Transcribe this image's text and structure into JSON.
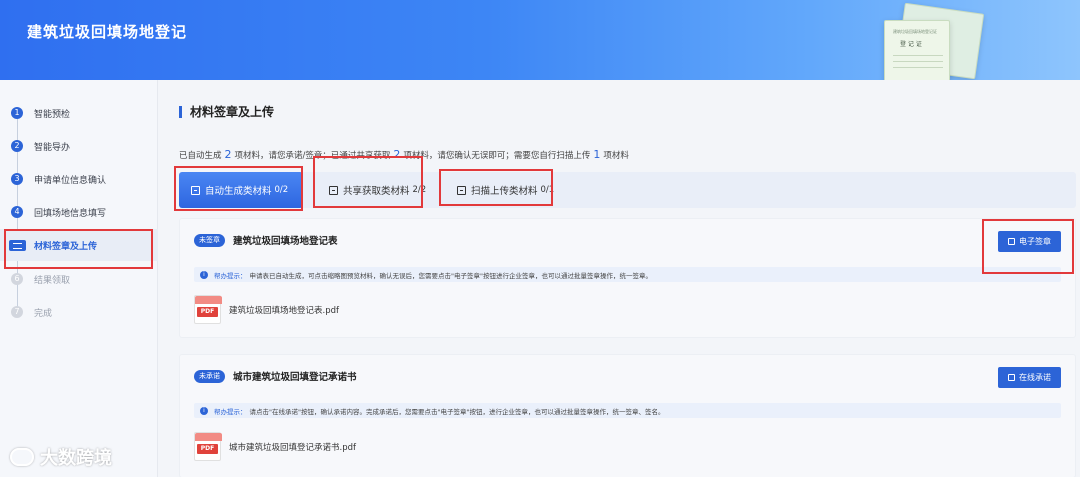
{
  "header": {
    "title": "建筑垃圾回填场地登记",
    "decor_cert_label": "登 记 证",
    "decor_cert_top": "建筑垃圾回填场地登记证"
  },
  "sidebar": {
    "steps": [
      {
        "num": "1",
        "label": "智能预检",
        "state": "done"
      },
      {
        "num": "2",
        "label": "智能导办",
        "state": "done"
      },
      {
        "num": "3",
        "label": "申请单位信息确认",
        "state": "done"
      },
      {
        "num": "4",
        "label": "回填场地信息填写",
        "state": "done"
      },
      {
        "num": "5",
        "label": "材料签章及上传",
        "state": "active"
      },
      {
        "num": "6",
        "label": "结果领取",
        "state": "pending"
      },
      {
        "num": "7",
        "label": "完成",
        "state": "pending"
      }
    ]
  },
  "main": {
    "section_title": "材料签章及上传",
    "summary": {
      "p1": "已自动生成",
      "n1": "2",
      "p2": "项材料，请您承诺/签章；已通过共享获取",
      "n2": "2",
      "p3": "项材料，请您确认无误即可；需要您自行扫描上传",
      "n3": "1",
      "p4": "项材料"
    },
    "tabs": [
      {
        "label": "自动生成类材料",
        "count": "0/2",
        "active": true
      },
      {
        "label": "共享获取类材料",
        "count": "2/2",
        "active": false
      },
      {
        "label": "扫描上传类材料",
        "count": "0/1",
        "active": false
      }
    ],
    "cards": [
      {
        "badge": "未签章",
        "name": "建筑垃圾回填场地登记表",
        "button": "电子签章",
        "tip_label": "帮办提示：",
        "tip": "申请表已自动生成，可点击缩略图预览材料，确认无误后，您需要点击\"电子签章\"按钮进行企业签章，也可以通过批量签章操作，统一签章。",
        "file": "建筑垃圾回填场地登记表.pdf"
      },
      {
        "badge": "未承诺",
        "name": "城市建筑垃圾回填登记承诺书",
        "button": "在线承诺",
        "tip_label": "帮办提示：",
        "tip": "请点击\"在线承诺\"按钮，确认承诺内容。完成承诺后，您需要点击\"电子签章\"按钮，进行企业签章，也可以通过批量签章操作，统一签章、签名。",
        "file": "城市建筑垃圾回填登记承诺书.pdf"
      }
    ],
    "pdf_label": "PDF"
  },
  "watermark": "大数跨境",
  "colors": {
    "accent": "#2c64d7",
    "highlight": "#e2393b"
  }
}
